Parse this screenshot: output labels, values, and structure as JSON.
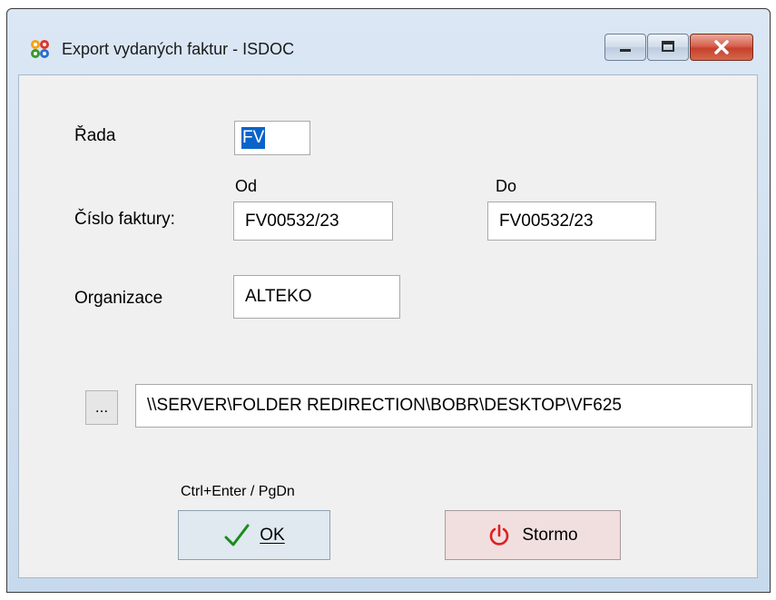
{
  "window": {
    "title": "Export vydaných faktur - ISDOC",
    "icon": "app-gears-icon",
    "controls": {
      "minimize": "minimize-icon",
      "maximize": "maximize-icon",
      "close": "close-icon"
    }
  },
  "form": {
    "rada": {
      "label": "Řada",
      "value": "FV"
    },
    "cislo": {
      "label": "Číslo faktury:",
      "od_label": "Od",
      "od_value": "FV00532/23",
      "do_label": "Do",
      "do_value": "FV00532/23"
    },
    "organizace": {
      "label": "Organizace",
      "value": "ALTEKO"
    },
    "path": {
      "browse_label": "...",
      "value": "\\\\SERVER\\FOLDER REDIRECTION\\BOBR\\DESKTOP\\VF625"
    }
  },
  "actions": {
    "shortcut_hint": "Ctrl+Enter / PgDn",
    "ok_label": "OK",
    "cancel_label": "Stormo"
  },
  "colors": {
    "ok_bg": "#dfe9ef",
    "cancel_bg": "#f1dfdf",
    "check": "#1c8b1c",
    "power": "#e02020",
    "selection": "#0a63c9"
  }
}
